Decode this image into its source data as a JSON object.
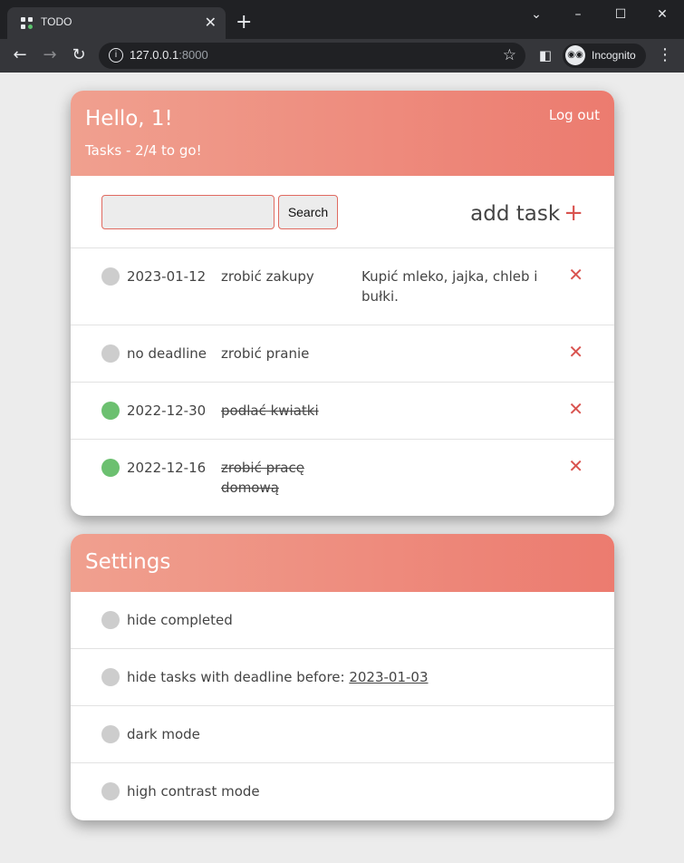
{
  "browser": {
    "tab_title": "TODO",
    "tab_close": "✕",
    "new_tab": "+",
    "url_host": "127.0.0.1",
    "url_port": ":8000",
    "incognito_label": "Incognito"
  },
  "header": {
    "greeting": "Hello, 1!",
    "tasks_status": "Tasks - 2/4 to go!",
    "logout_label": "Log out"
  },
  "search": {
    "value": "",
    "button_label": "Search"
  },
  "add_task": {
    "label": "add task",
    "plus": "+"
  },
  "tasks": [
    {
      "date": "2023-01-12",
      "title": "zrobić zakupy",
      "description": "Kupić mleko, jajka, chleb i bułki.",
      "done": false,
      "delete": "✕"
    },
    {
      "date": "no deadline",
      "title": "zrobić pranie",
      "description": "",
      "done": false,
      "delete": "✕"
    },
    {
      "date": "2022-12-30",
      "title": "podlać kwiatki",
      "description": "",
      "done": true,
      "delete": "✕"
    },
    {
      "date": "2022-12-16",
      "title": "zrobić pracę domową",
      "description": "",
      "done": true,
      "delete": "✕"
    }
  ],
  "settings": {
    "title": "Settings",
    "items": [
      {
        "label": "hide completed"
      },
      {
        "label": "hide tasks with deadline before: ",
        "link": "2023-01-03"
      },
      {
        "label": "dark mode"
      },
      {
        "label": "high contrast mode"
      }
    ]
  },
  "colors": {
    "accent": "#ec7b6f",
    "done": "#6cc070",
    "delete": "#d9534f"
  }
}
